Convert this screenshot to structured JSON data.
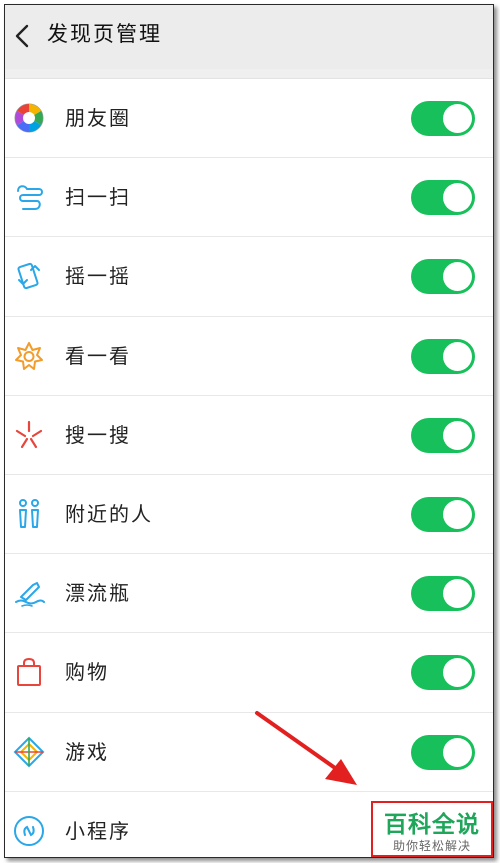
{
  "header": {
    "title": "发现页管理",
    "back_icon": "chevron-left-icon"
  },
  "settings": [
    {
      "label": "朋友圈",
      "icon": "moments-aperture-icon",
      "enabled": true
    },
    {
      "label": "扫一扫",
      "icon": "scan-icon",
      "enabled": true
    },
    {
      "label": "摇一摇",
      "icon": "shake-icon",
      "enabled": true
    },
    {
      "label": "看一看",
      "icon": "top-stories-icon",
      "enabled": true
    },
    {
      "label": "搜一搜",
      "icon": "search-sparkle-icon",
      "enabled": true
    },
    {
      "label": "附近的人",
      "icon": "people-nearby-icon",
      "enabled": true
    },
    {
      "label": "漂流瓶",
      "icon": "drift-bottle-icon",
      "enabled": true
    },
    {
      "label": "购物",
      "icon": "shopping-bag-icon",
      "enabled": true
    },
    {
      "label": "游戏",
      "icon": "games-diamond-icon",
      "enabled": true
    },
    {
      "label": "小程序",
      "icon": "mini-programs-icon",
      "enabled": false
    }
  ],
  "watermark": {
    "title": "百科全说",
    "subtitle": "助你轻松解决"
  },
  "colors": {
    "toggle_on": "#17c05a",
    "header_bg": "#ececec",
    "arrow": "#e32020"
  }
}
